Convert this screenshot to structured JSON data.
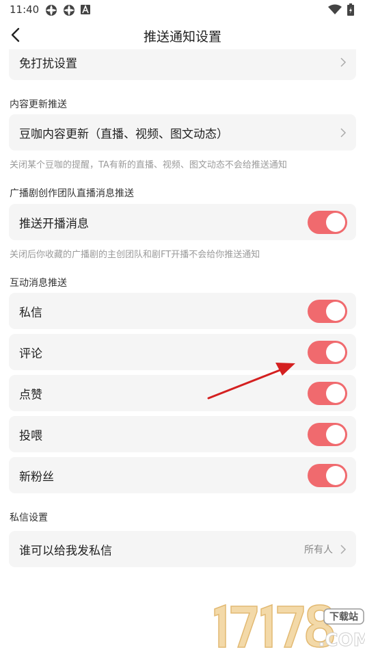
{
  "status_bar": {
    "time": "11:40"
  },
  "header": {
    "title": "推送通知设置"
  },
  "dnd": {
    "label": "免打扰设置"
  },
  "content_section": {
    "title": "内容更新推送",
    "row_label": "豆咖内容更新（直播、视频、图文动态）",
    "hint": "关闭某个豆咖的提醒，TA有新的直播、视频、图文动态不会给推送通知"
  },
  "team_section": {
    "title": "广播剧创作团队直播消息推送",
    "row_label": "推送开播消息",
    "hint": "关闭后你收藏的广播剧的主创团队和剧FT开播不会给你推送通知"
  },
  "interaction_section": {
    "title": "互动消息推送",
    "items": [
      {
        "label": "私信",
        "enabled": true
      },
      {
        "label": "评论",
        "enabled": true
      },
      {
        "label": "点赞",
        "enabled": true
      },
      {
        "label": "投喂",
        "enabled": true
      },
      {
        "label": "新粉丝",
        "enabled": true
      }
    ]
  },
  "dm_section": {
    "title": "私信设置",
    "row_label": "谁可以给我发私信",
    "value": "所有人"
  },
  "watermark": {
    "digits": "17178",
    "badge": "下载站",
    "domain": ".COM"
  },
  "colors": {
    "toggle_on": "#f06a6e",
    "card_bg": "#f5f5f5",
    "arrow": "#d42020"
  }
}
